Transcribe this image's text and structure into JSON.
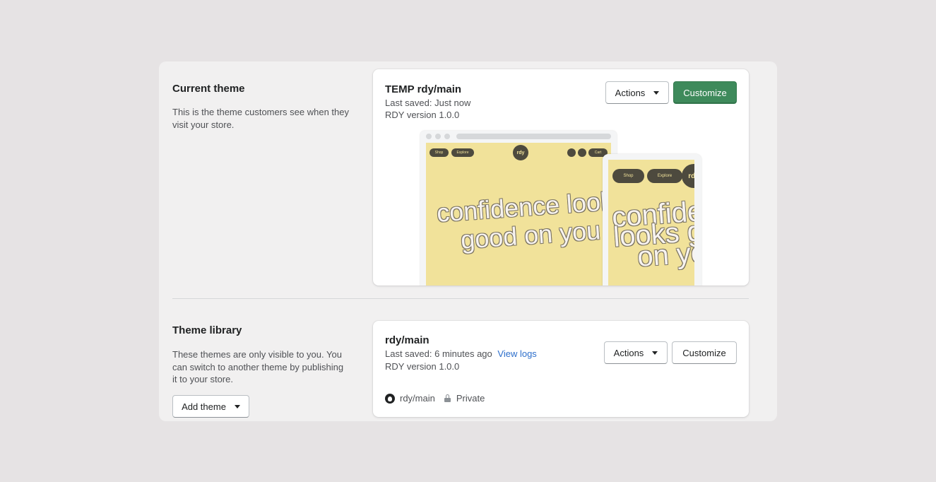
{
  "current_section": {
    "title": "Current theme",
    "description": "This is the theme customers see when they visit your store."
  },
  "current_theme": {
    "prefix": "TEMP",
    "name": "rdy/main",
    "saved": "Last saved: Just now",
    "version": "RDY version 1.0.0",
    "actions_label": "Actions",
    "customize_label": "Customize",
    "preview": {
      "nav_shop": "Shop",
      "nav_explore": "Explore",
      "nav_cart": "Cart",
      "logo": "rdy",
      "hero_line1": "confidence looks",
      "hero_line2": "good on you",
      "mobile_line1": "confiden",
      "mobile_line2": "looks go",
      "mobile_line3": "on yo",
      "preview_bg": "#f1e29a"
    }
  },
  "library_section": {
    "title": "Theme library",
    "description": "These themes are only visible to you. You can switch to another theme by publishing it to your store.",
    "add_theme_label": "Add theme"
  },
  "library_theme": {
    "name": "rdy/main",
    "saved": "Last saved: 6 minutes ago",
    "view_logs": "View logs",
    "version": "RDY version 1.0.0",
    "actions_label": "Actions",
    "customize_label": "Customize",
    "repo": "rdy/main",
    "visibility": "Private"
  },
  "colors": {
    "primary": "#3e8a5b",
    "link": "#2c6ecb",
    "background": "#e6e3e4"
  }
}
